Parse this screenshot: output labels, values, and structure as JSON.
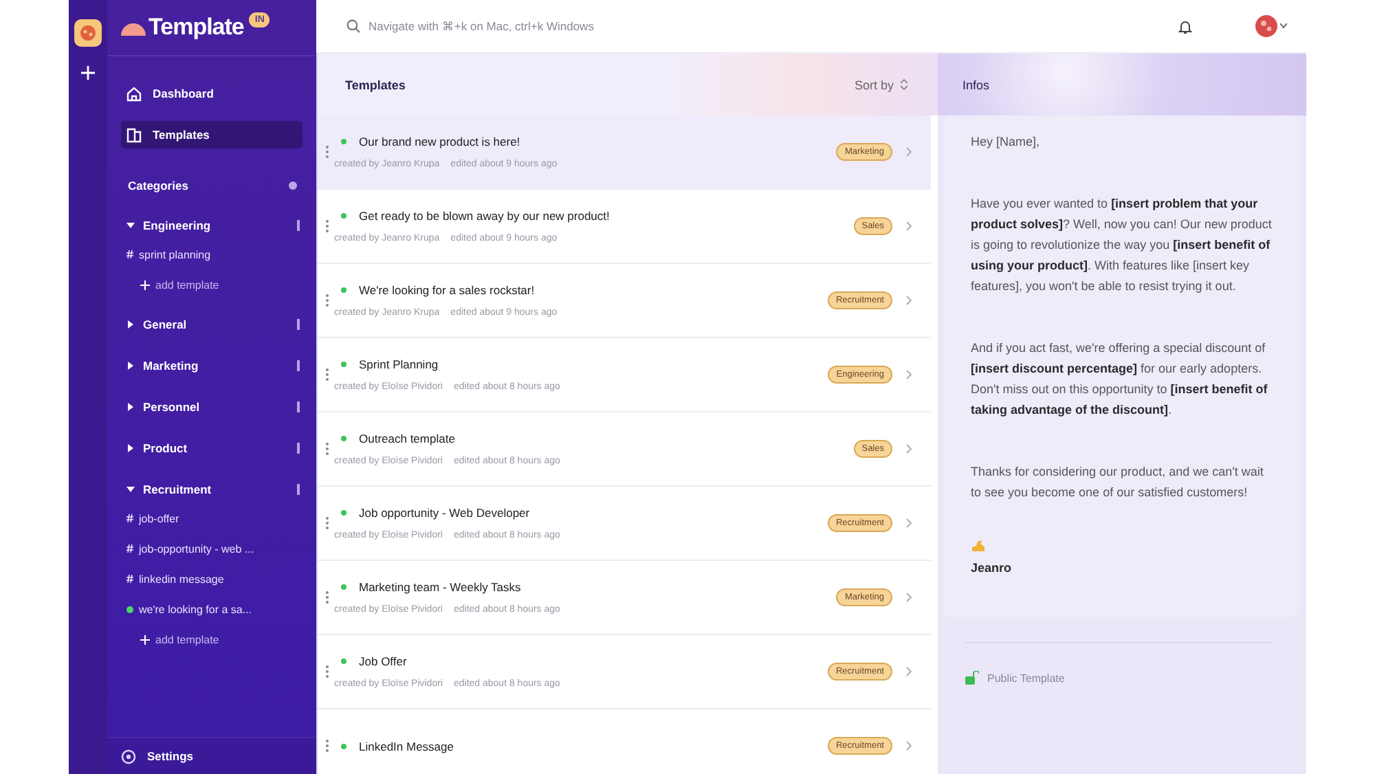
{
  "app": {
    "name": "Template",
    "badge": "IN"
  },
  "sidebar": {
    "items": [
      {
        "label": "Dashboard",
        "kind": "home",
        "selected": false
      },
      {
        "label": "Templates",
        "kind": "templates",
        "selected": true
      }
    ],
    "categories_title": "Categories",
    "categories": [
      {
        "name": "Engineering",
        "expanded": true,
        "children": [
          {
            "label": "sprint planning",
            "kind": "hash"
          },
          {
            "label": "add template",
            "kind": "add"
          }
        ]
      },
      {
        "name": "General",
        "expanded": false
      },
      {
        "name": "Marketing",
        "expanded": false
      },
      {
        "name": "Personnel",
        "expanded": false
      },
      {
        "name": "Product",
        "expanded": false
      },
      {
        "name": "Recruitment",
        "expanded": true,
        "children": [
          {
            "label": "job-offer",
            "kind": "hash"
          },
          {
            "label": "job-opportunity - web ...",
            "kind": "hash"
          },
          {
            "label": "linkedin message",
            "kind": "hash"
          },
          {
            "label": "we're looking for a sa...",
            "kind": "dot"
          },
          {
            "label": "add template",
            "kind": "add"
          }
        ]
      }
    ],
    "settings": "Settings"
  },
  "search": {
    "placeholder": "Navigate with ⌘+k on Mac, ctrl+k Windows"
  },
  "templates": {
    "title": "Templates",
    "sort": "Sort by",
    "rows": [
      {
        "title": "Our brand new product is here!",
        "author": "created by Jeanro Krupa",
        "edited": "edited about 9 hours ago",
        "tag": "Marketing",
        "selected": true
      },
      {
        "title": "Get ready to be blown away by our new product!",
        "author": "created by Jeanro Krupa",
        "edited": "edited about 9 hours ago",
        "tag": "Sales",
        "selected": false
      },
      {
        "title": "We're looking for a sales rockstar!",
        "author": "created by Jeanro Krupa",
        "edited": "edited about 9 hours ago",
        "tag": "Recruitment",
        "selected": false
      },
      {
        "title": "Sprint Planning",
        "author": "created by Eloïse Pividori",
        "edited": "edited about 8 hours ago",
        "tag": "Engineering",
        "selected": false
      },
      {
        "title": "Outreach template",
        "author": "created by Eloïse Pividori",
        "edited": "edited about 8 hours ago",
        "tag": "Sales",
        "selected": false
      },
      {
        "title": "Job opportunity - Web Developer",
        "author": "created by Eloïse Pividori",
        "edited": "edited about 8 hours ago",
        "tag": "Recruitment",
        "selected": false
      },
      {
        "title": "Marketing team - Weekly Tasks",
        "author": "created by Eloïse Pividori",
        "edited": "edited about 8 hours ago",
        "tag": "Marketing",
        "selected": false
      },
      {
        "title": "Job Offer",
        "author": "created by Eloïse Pividori",
        "edited": "edited about 8 hours ago",
        "tag": "Recruitment",
        "selected": false
      },
      {
        "title": "LinkedIn Message",
        "tag": "Recruitment",
        "selected": false
      }
    ]
  },
  "info": {
    "title": "Infos",
    "paragraphs": [
      "Hey [Name],",
      "Have you ever wanted to **[insert problem that your product solves]**? Well, now you can! Our new product is going to revolutionize the way you **[insert benefit of using your product]**. With features like [insert key features], you won't be able to resist trying it out.",
      "And if you act fast, we're offering a special discount of **[insert discount percentage]** for our early adopters. Don't miss out on this opportunity to **[insert benefit of taking advantage of the discount]**.",
      "Thanks for considering our product, and we can't wait to see you become one of our satisfied customers!"
    ],
    "signature": "Jeanro",
    "visibility": "Public Template"
  }
}
